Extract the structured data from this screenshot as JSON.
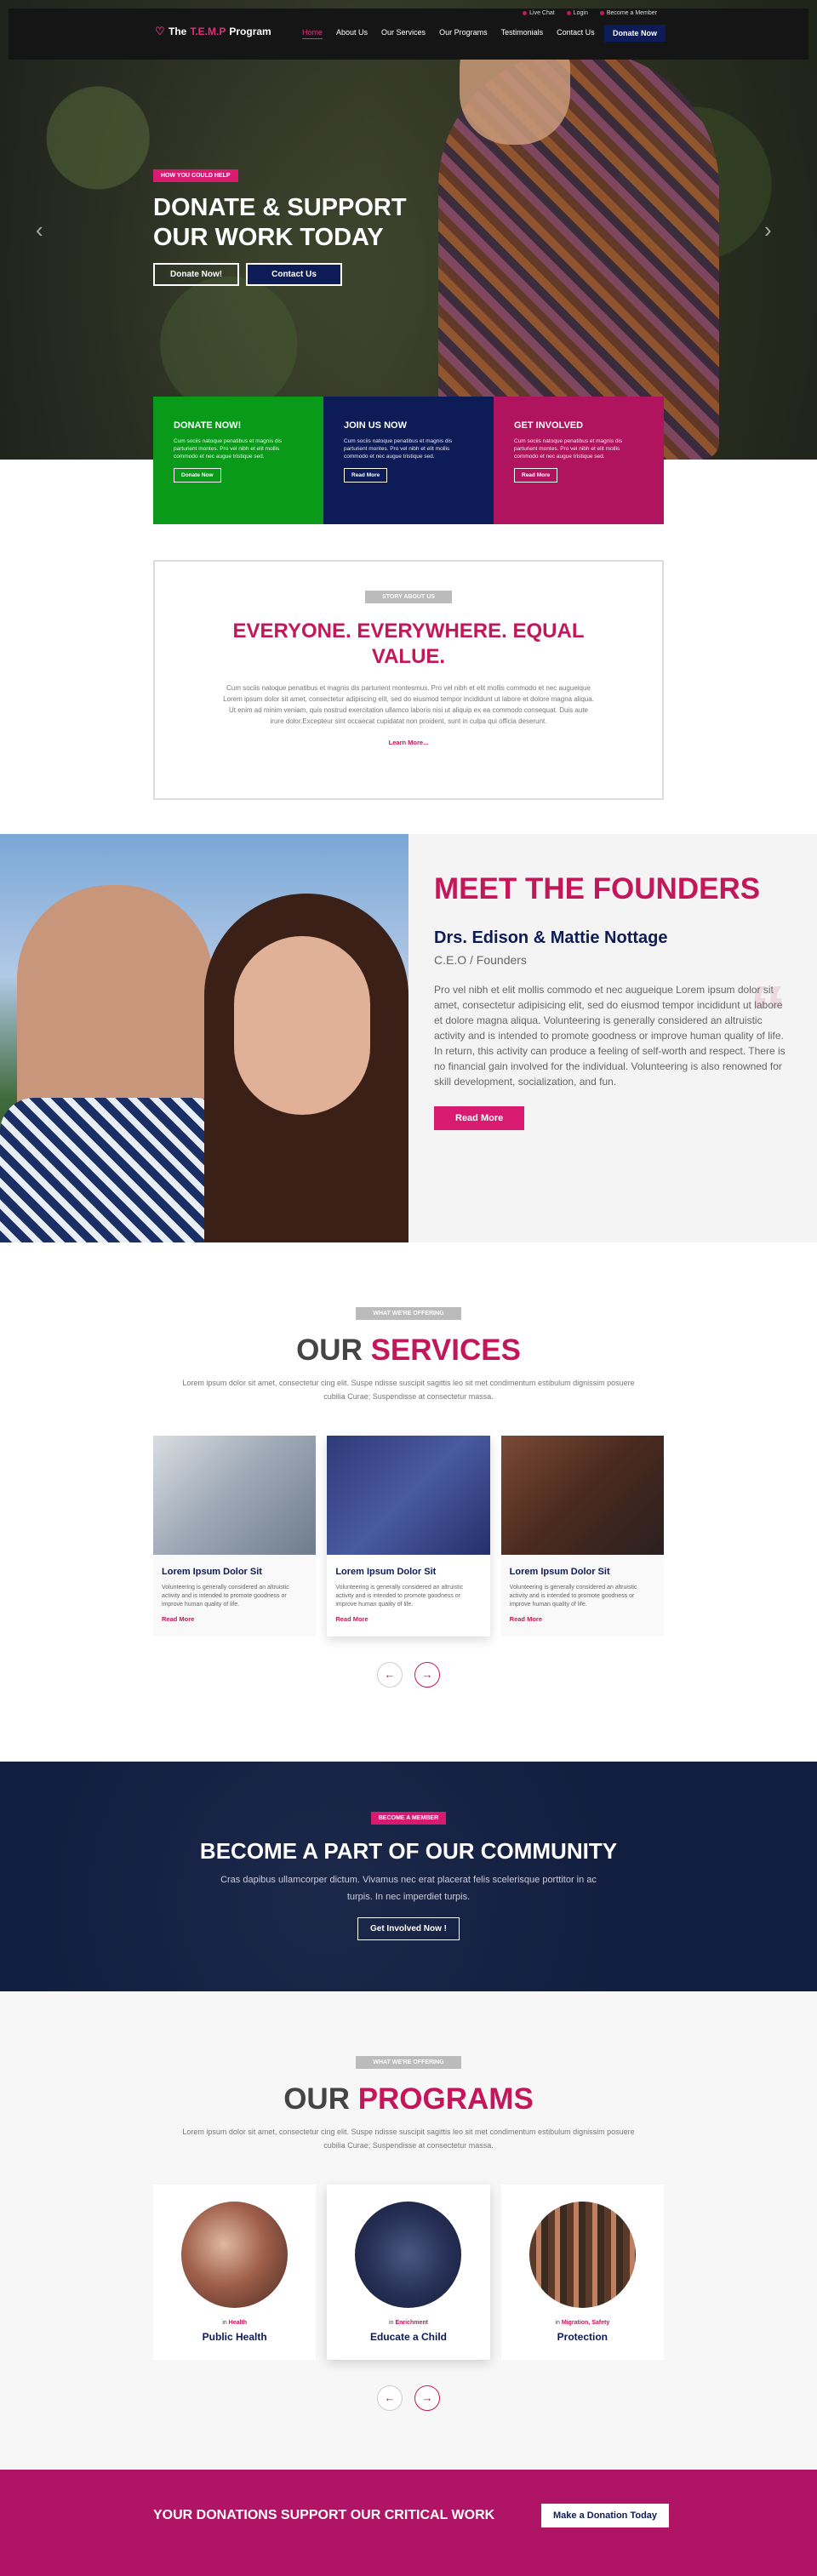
{
  "header": {
    "util_links": [
      "Live Chat",
      "Login",
      "Become a Member"
    ],
    "logo_prefix": "The",
    "logo_accent": "T.E.M.P",
    "logo_suffix": "Program",
    "nav": [
      "Home",
      "About Us",
      "Our Services",
      "Our Programs",
      "Testimonials",
      "Contact Us"
    ],
    "donate_label": "Donate Now"
  },
  "hero": {
    "badge": "HOW YOU COULD HELP",
    "title": "DONATE & SUPPORT OUR WORK TODAY",
    "btn_donate": "Donate Now!",
    "btn_contact": "Contact Us",
    "prev_arrow": "‹",
    "next_arrow": "›"
  },
  "cta": [
    {
      "title": "DONATE NOW!",
      "text": "Cum sociis natoque penatibus et magnis dis parturient montes. Pro vel nibh et elit mollis commodo et nec augue tristique sed.",
      "button": "Donate Now",
      "color": "#0a9a1a"
    },
    {
      "title": "JOIN US NOW",
      "text": "Cum sociis natoque penatibus et magnis dis parturient montes. Pro vel nibh et elit mollis commodo et nec augue tristique sed.",
      "button": "Read More",
      "color": "#0d1b57"
    },
    {
      "title": "GET INVOLVED",
      "text": "Cum sociis natoque penatibus et magnis dis parturient montes. Pro vel nibh et elit mollis commodo et nec augue tristique sed.",
      "button": "Read More",
      "color": "#b0145e"
    }
  ],
  "story": {
    "badge": "STORY ABOUT US",
    "title": "EVERYONE. EVERYWHERE. EQUAL VALUE.",
    "body": "Cum sociis natoque penatibus et magnis dis parturient montesmus. Pro vel nibh et elit mollis commodo et nec augueique Lorem ipsum dolor sit amet, consectetur adipiscing elit, sed do eiusmod tempor incididunt ut labore et dolore magna aliqua. Ut enim ad minim veniam, quis nostrud exercitation ullamco laboris nisi ut aliquip ex ea commodo consequat. Duis aute irure dolor.Excepteur sint occaecat cupidatat non proident, sunt in culpa qui officia deserunt.",
    "link": "Learn More..."
  },
  "founders": {
    "title": "MEET THE FOUNDERS",
    "names": "Drs. Edison & Mattie Nottage",
    "role": "C.E.O / Founders",
    "body": "Pro vel nibh et elit mollis commodo et nec augueique Lorem ipsum dolor sit amet, consectetur adipisicing elit, sed do eiusmod tempor incididunt ut labore et dolore magna aliqua. Volunteering is generally considered an altruistic activity and is intended to promote goodness or improve human quality of life. In return, this activity can produce a feeling of self-worth and respect. There is no financial gain involved for the individual. Volunteering is also renowned for skill development, socialization, and fun.",
    "button": "Read More",
    "quote_mark": "“"
  },
  "services": {
    "badge": "WHAT WE'RE OFFERING",
    "title_a": "OUR ",
    "title_b": "SERVICES",
    "subtitle": "Lorem ipsum dolor sit amet, consectetur cing elit. Suspe ndisse suscipit sagittis leo sit met condimentum estibulum dignissim posuere cubilia Curae; Suspendisse at consectetur massa.",
    "cards": [
      {
        "title": "Lorem Ipsum Dolor Sit",
        "text": "Volunteering is generally considered an altruistic activity and is intended to promote goodness or improve human quality of life.",
        "link": "Read More"
      },
      {
        "title": "Lorem Ipsum Dolor Sit",
        "text": "Volunteering is generally considered an altruistic activity and is intended to promote goodness or improve human quality of life.",
        "link": "Read More"
      },
      {
        "title": "Lorem Ipsum Dolor Sit",
        "text": "Volunteering is generally considered an altruistic activity and is intended to promote goodness or improve human quality of life.",
        "link": "Read More"
      }
    ],
    "prev": "←",
    "next": "→"
  },
  "community": {
    "badge": "BECOME A MEMBER",
    "title": "BECOME A PART OF OUR COMMUNITY",
    "text": "Cras dapibus ullamcorper dictum. Vivamus nec erat placerat felis scelerisque porttitor in ac turpis. In nec imperdiet turpis.",
    "button": "Get Involved Now !"
  },
  "programs": {
    "badge": "WHAT WE'RE OFFERING",
    "title_a": "OUR ",
    "title_b": "PROGRAMS",
    "subtitle": "Lorem ipsum dolor sit amet, consectetur cing elit. Suspe ndisse suscipit sagittis leo sit met condimentum estibulum dignissim posuere cubilia Curae; Suspendisse at consectetur massa.",
    "items": [
      {
        "cat_a": "in ",
        "cat_b": "Health",
        "title": "Public Health"
      },
      {
        "cat_a": "in ",
        "cat_b": "Enrichment",
        "title": "Educate a Child"
      },
      {
        "cat_a": "in ",
        "cat_b": "Migration, Safety",
        "title": "Protection"
      }
    ],
    "prev": "←",
    "next": "→"
  },
  "footer": {
    "text": "YOUR DONATIONS SUPPORT OUR CRITICAL WORK",
    "button": "Make a Donation Today"
  }
}
